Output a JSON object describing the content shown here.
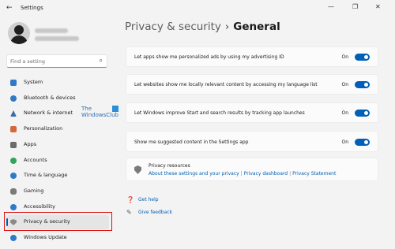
{
  "window": {
    "app_title": "Settings",
    "back_glyph": "←",
    "controls": [
      "—",
      "❐",
      "✕"
    ]
  },
  "sidebar": {
    "search_placeholder": "Find a setting",
    "search_icon": "⌕",
    "watermark": [
      "The",
      "WindowsClub"
    ],
    "items": [
      {
        "label": "System",
        "icon": "system-icon",
        "color": "#2f79c6"
      },
      {
        "label": "Bluetooth & devices",
        "icon": "bluetooth-icon",
        "color": "#2f79c6"
      },
      {
        "label": "Network & internet",
        "icon": "network-icon",
        "color": "#3a6ea5"
      },
      {
        "label": "Personalization",
        "icon": "personalization-icon",
        "color": "#d3693a"
      },
      {
        "label": "Apps",
        "icon": "apps-icon",
        "color": "#6b6b6b"
      },
      {
        "label": "Accounts",
        "icon": "accounts-icon",
        "color": "#2fa65a"
      },
      {
        "label": "Time & language",
        "icon": "time-language-icon",
        "color": "#2f79c6"
      },
      {
        "label": "Gaming",
        "icon": "gaming-icon",
        "color": "#7a7a7a"
      },
      {
        "label": "Accessibility",
        "icon": "accessibility-icon",
        "color": "#2f79c6"
      },
      {
        "label": "Privacy & security",
        "icon": "shield-icon",
        "color": "#8a8a8a",
        "active": true
      },
      {
        "label": "Windows Update",
        "icon": "windows-update-icon",
        "color": "#2f79c6"
      }
    ]
  },
  "header": {
    "breadcrumb_parent": "Privacy & security",
    "breadcrumb_sep": "›",
    "breadcrumb_current": "General"
  },
  "settings": [
    {
      "label": "Let apps show me personalized ads by using my advertising ID",
      "state": "On"
    },
    {
      "label": "Let websites show me locally relevant content by accessing my language list",
      "state": "On"
    },
    {
      "label": "Let Windows improve Start and search results by tracking app launches",
      "state": "On"
    },
    {
      "label": "Show me suggested content in the Settings app",
      "state": "On"
    }
  ],
  "resources": {
    "title": "Privacy resources",
    "links": [
      "About these settings and your privacy",
      "Privacy dashboard",
      "Privacy Statement"
    ],
    "separator": "|"
  },
  "help": {
    "get_help": "Get help",
    "give_feedback": "Give feedback"
  },
  "colors": {
    "accent": "#005fb8",
    "highlight_box": "#e01010"
  }
}
